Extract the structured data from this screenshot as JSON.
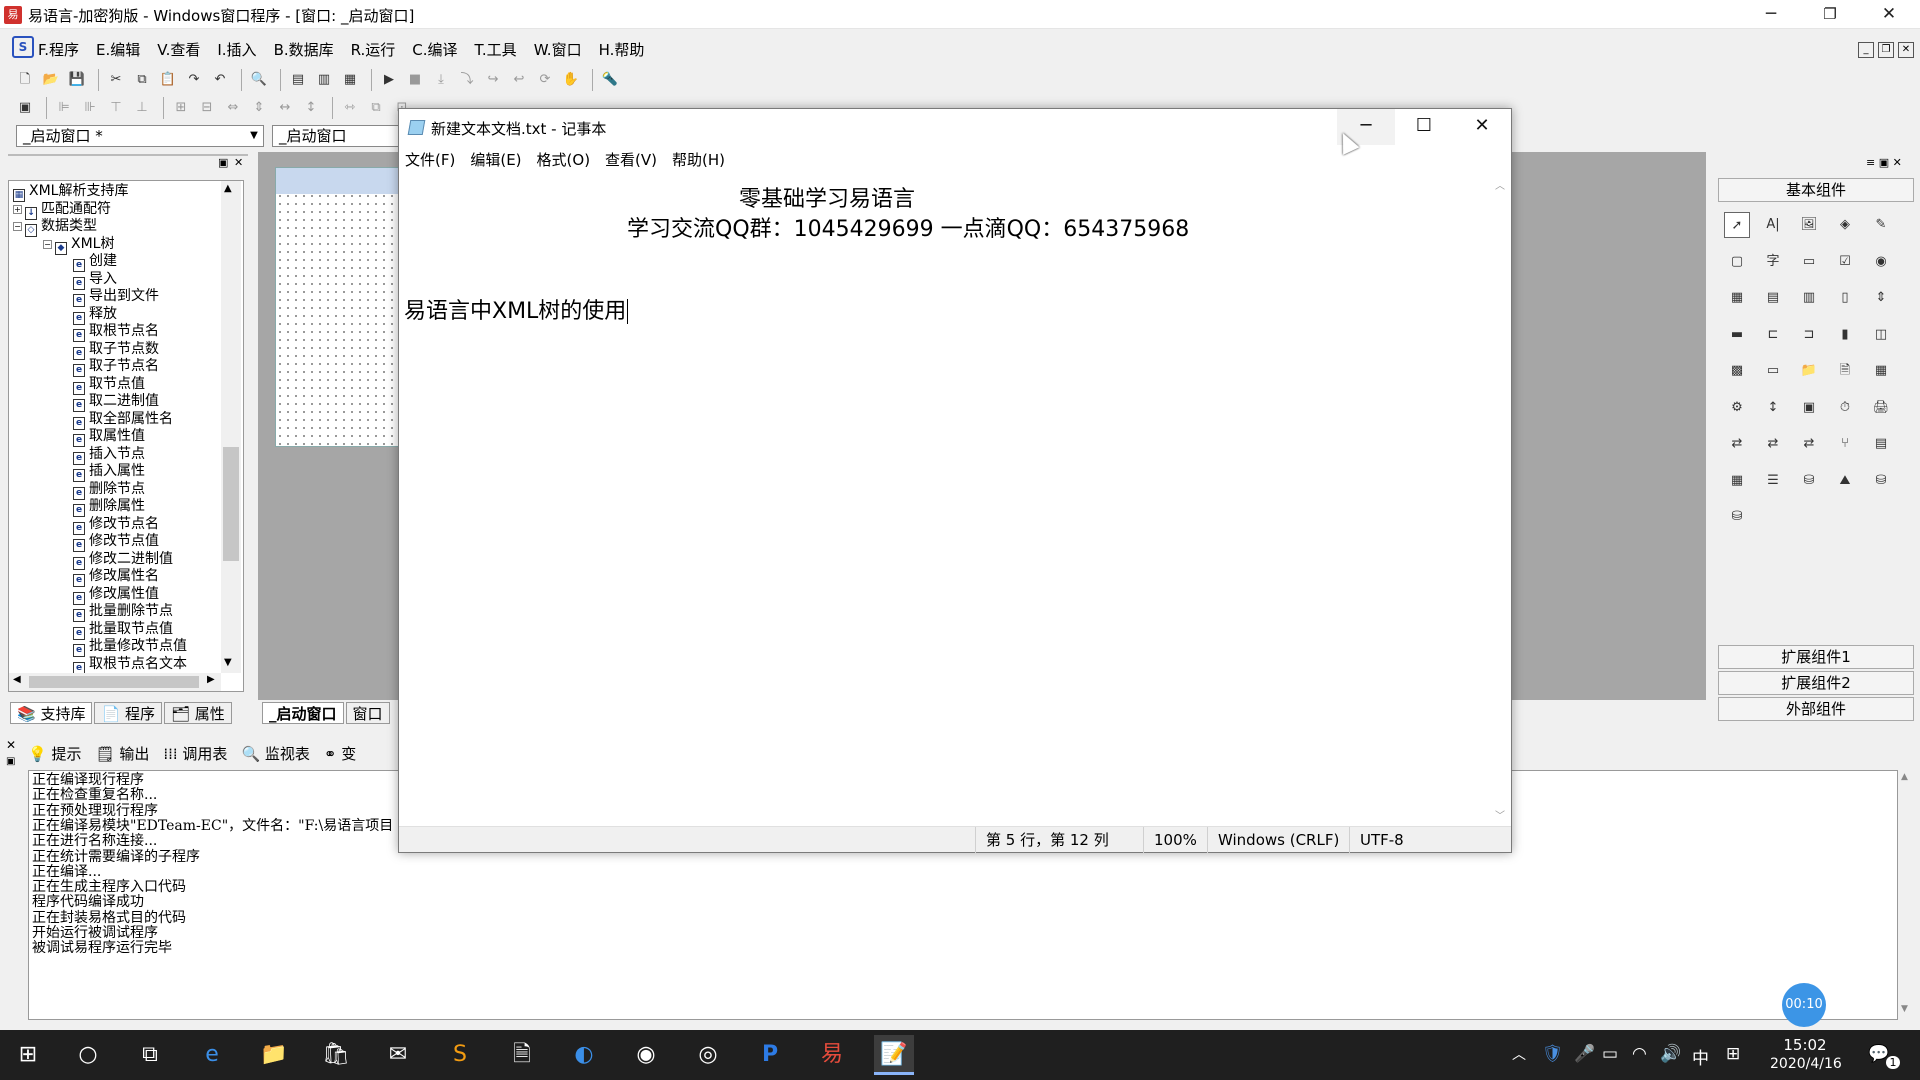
{
  "window": {
    "title": "易语言-加密狗版 - Windows窗口程序 - [窗口: _启动窗口]",
    "minimize": "─",
    "maximize": "❐",
    "close": "✕"
  },
  "menu": [
    "F.程序",
    "E.编辑",
    "V.查看",
    "I.插入",
    "B.数据库",
    "R.运行",
    "C.编译",
    "T.工具",
    "W.窗口",
    "H.帮助"
  ],
  "mdi_controls": [
    "_",
    "❐",
    "✕"
  ],
  "combos": {
    "left": "_启动窗口 *",
    "right": "_启动窗口"
  },
  "tree": {
    "rows": [
      {
        "label": "XML解析支持库",
        "level": 0,
        "exp": "",
        "icon": "▦"
      },
      {
        "label": "匹配通配符",
        "level": 0,
        "exp": "+",
        "icon": "↓"
      },
      {
        "label": "数据类型",
        "level": 0,
        "exp": "−",
        "icon": "◇"
      },
      {
        "label": "XML树",
        "level": 1,
        "exp": "−",
        "icon": "◆"
      },
      {
        "label": "创建",
        "level": 2,
        "exp": "",
        "icon": "e"
      },
      {
        "label": "导入",
        "level": 2,
        "exp": "",
        "icon": "e"
      },
      {
        "label": "导出到文件",
        "level": 2,
        "exp": "",
        "icon": "e"
      },
      {
        "label": "释放",
        "level": 2,
        "exp": "",
        "icon": "e"
      },
      {
        "label": "取根节点名",
        "level": 2,
        "exp": "",
        "icon": "e"
      },
      {
        "label": "取子节点数",
        "level": 2,
        "exp": "",
        "icon": "e"
      },
      {
        "label": "取子节点名",
        "level": 2,
        "exp": "",
        "icon": "e"
      },
      {
        "label": "取节点值",
        "level": 2,
        "exp": "",
        "icon": "e"
      },
      {
        "label": "取二进制值",
        "level": 2,
        "exp": "",
        "icon": "e"
      },
      {
        "label": "取全部属性名",
        "level": 2,
        "exp": "",
        "icon": "e"
      },
      {
        "label": "取属性值",
        "level": 2,
        "exp": "",
        "icon": "e"
      },
      {
        "label": "插入节点",
        "level": 2,
        "exp": "",
        "icon": "e"
      },
      {
        "label": "插入属性",
        "level": 2,
        "exp": "",
        "icon": "e"
      },
      {
        "label": "删除节点",
        "level": 2,
        "exp": "",
        "icon": "e"
      },
      {
        "label": "删除属性",
        "level": 2,
        "exp": "",
        "icon": "e"
      },
      {
        "label": "修改节点名",
        "level": 2,
        "exp": "",
        "icon": "e"
      },
      {
        "label": "修改节点值",
        "level": 2,
        "exp": "",
        "icon": "e"
      },
      {
        "label": "修改二进制值",
        "level": 2,
        "exp": "",
        "icon": "e"
      },
      {
        "label": "修改属性名",
        "level": 2,
        "exp": "",
        "icon": "e"
      },
      {
        "label": "修改属性值",
        "level": 2,
        "exp": "",
        "icon": "e"
      },
      {
        "label": "批量删除节点",
        "level": 2,
        "exp": "",
        "icon": "e"
      },
      {
        "label": "批量取节点值",
        "level": 2,
        "exp": "",
        "icon": "e"
      },
      {
        "label": "批量修改节点值",
        "level": 2,
        "exp": "",
        "icon": "e"
      },
      {
        "label": "取根节点名文本",
        "level": 2,
        "exp": "",
        "icon": "e"
      }
    ]
  },
  "left_tabs": [
    "支持库",
    "程序",
    "属性"
  ],
  "design_tabs": [
    "_启动窗口",
    "窗口"
  ],
  "components": {
    "basic": "基本组件",
    "ext1": "扩展组件1",
    "ext2": "扩展组件2",
    "external": "外部组件"
  },
  "output": {
    "tabs": [
      "提示",
      "输出",
      "调用表",
      "监视表",
      "变"
    ],
    "lines": [
      "正在编译现行程序",
      "正在检查重复名称...",
      "正在预处理现行程序",
      "正在编译易模块\"EDTeam-EC\"，文件名：\"F:\\易语言项目",
      "正在进行名称连接...",
      "正在统计需要编译的子程序",
      "正在编译...",
      "正在生成主程序入口代码",
      "程序代码编译成功",
      "正在封装易格式目的代码",
      "开始运行被调试程序",
      "被调试易程序运行完毕"
    ]
  },
  "notepad": {
    "title": "新建文本文档.txt - 记事本",
    "menu": [
      "文件(F)",
      "编辑(E)",
      "格式(O)",
      "查看(V)",
      "帮助(H)"
    ],
    "lines": [
      "零基础学习易语言",
      "学习交流QQ群：1045429699  一点滴QQ：654375968",
      "易语言中XML树的使用"
    ],
    "status": {
      "position": "第 5 行，第 12 列",
      "zoom": "100%",
      "eol": "Windows (CRLF)",
      "encoding": "UTF-8"
    }
  },
  "taskbar": {
    "time": "15:02",
    "date": "2020/4/16",
    "ime": "中",
    "notif_count": "1",
    "rec_timer": "00:10"
  }
}
